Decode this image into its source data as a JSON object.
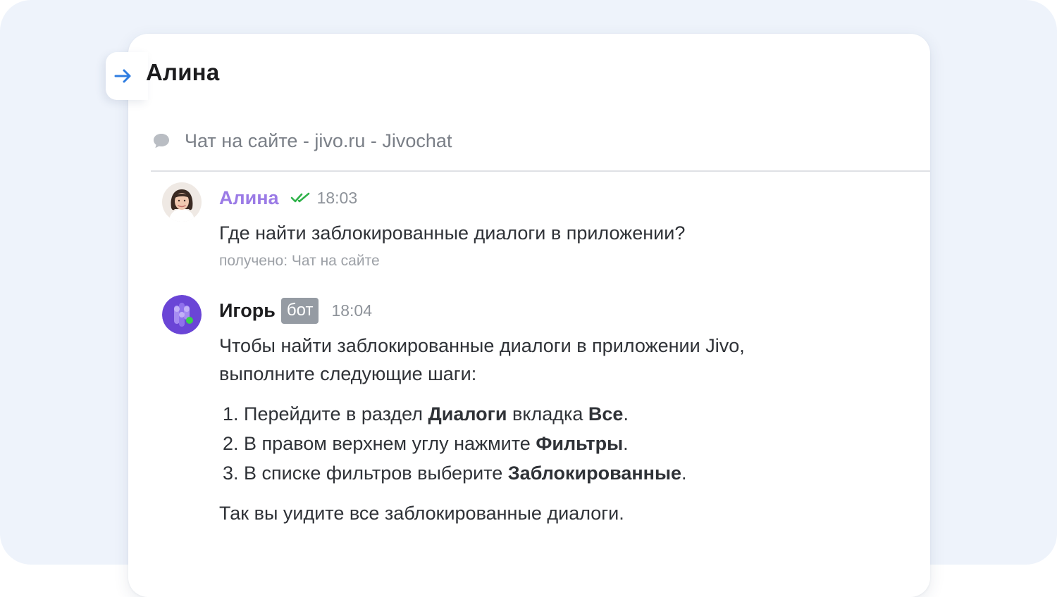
{
  "header": {
    "title": "Алина",
    "collapse_icon": "arrow-right-icon"
  },
  "channel": {
    "icon": "chat-bubble-icon",
    "label": "Чат на сайте - jivo.ru - Jivochat"
  },
  "messages": [
    {
      "author": "Алина",
      "time": "18:03",
      "status_icon": "double-check-icon",
      "text": "Где найти заблокированные диалоги в приложении?",
      "received": "получено: Чат на сайте"
    },
    {
      "author": "Игорь",
      "badge": "бот",
      "time": "18:04",
      "intro_line1": "Чтобы найти заблокированные диалоги в приложении Jivo,",
      "intro_line2": "выполните следующие шаги:",
      "steps": [
        {
          "num": "1.",
          "pre": "Перейдите в раздел ",
          "bold1": "Диалоги",
          "mid": " вкладка ",
          "bold2": "Все",
          "post": "."
        },
        {
          "num": "2.",
          "pre": "В правом верхнем углу нажмите ",
          "bold1": "Фильтры",
          "post": "."
        },
        {
          "num": "3.",
          "pre": "В списке фильтров выберите ",
          "bold1": "Заблокированные",
          "post": "."
        }
      ],
      "outro": "Так вы уидите все заблокированные диалоги."
    }
  ],
  "colors": {
    "background": "#eef3fb",
    "accent_blue": "#2f7de1",
    "alina_name": "#9b7be6",
    "read_check": "#2fb24a",
    "bot_badge": "#959ba3",
    "bot_avatar": "#6a45d6"
  }
}
